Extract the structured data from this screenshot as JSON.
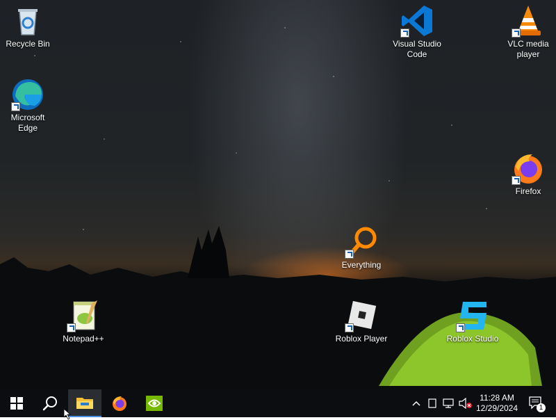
{
  "desktop": {
    "icons": [
      {
        "label": "Recycle Bin"
      },
      {
        "label": "Microsoft Edge"
      },
      {
        "label": "Visual Studio Code"
      },
      {
        "label": "VLC media player"
      },
      {
        "label": "Firefox"
      },
      {
        "label": "Everything"
      },
      {
        "label": "Notepad++"
      },
      {
        "label": "Roblox Player"
      },
      {
        "label": "Roblox Studio"
      }
    ]
  },
  "taskbar": {
    "pinned": [
      {
        "icon": "start-icon"
      },
      {
        "icon": "search-icon"
      },
      {
        "icon": "file-explorer-icon"
      },
      {
        "icon": "firefox-icon"
      },
      {
        "icon": "nvidia-icon"
      }
    ],
    "clock": {
      "time": "11:28 AM",
      "date": "12/29/2024"
    },
    "notification_count": "1"
  }
}
